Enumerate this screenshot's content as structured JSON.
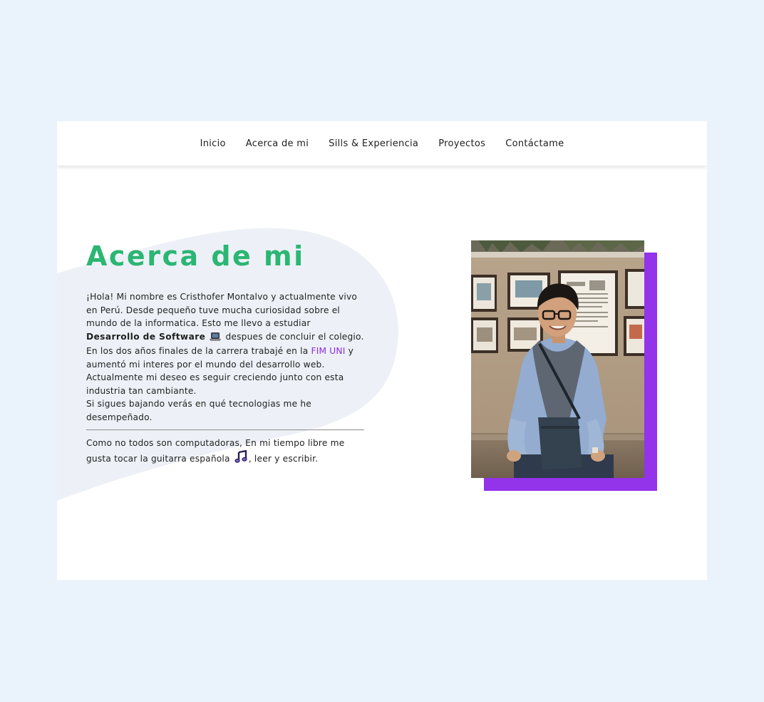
{
  "nav": {
    "items": [
      {
        "label": "Inicio"
      },
      {
        "label": "Acerca de mi"
      },
      {
        "label": "Sills & Experiencia"
      },
      {
        "label": "Proyectos"
      },
      {
        "label": "Contáctame"
      }
    ]
  },
  "about": {
    "title": "Acerca de mi",
    "intro": "¡Hola! Mi nombre es Cristhofer Montalvo y actualmente vivo en Perú. Desde pequeño tuve mucha curiosidad sobre el mundo de la informatica. Esto me llevo a estudiar",
    "highlight": "Desarrollo de Software",
    "after_highlight": "despues de concluir el colegio. En los dos años finales de la carrera trabajé en la",
    "link": "FIM UNI",
    "after_link": "y aumentó mi interes por el mundo del desarrollo web.",
    "line2": "Actualmente mi deseo es seguir creciendo junto con esta industria tan cambiante.",
    "line3": "Si sigues bajando verás en qué tecnologias me he desempeñado.",
    "hobby_before": "Como no todos son computadoras, En mi tiempo libre me gusta tocar la guitarra española",
    "hobby_after": ", leer y escribir."
  },
  "icons": {
    "laptop": "laptop-icon",
    "music": "music-notes-icon"
  },
  "colors": {
    "page_bg": "#eaf2fb",
    "title": "#2bb673",
    "accent": "#9333ea",
    "link": "#8a2be2",
    "blob": "#edf1f7"
  }
}
